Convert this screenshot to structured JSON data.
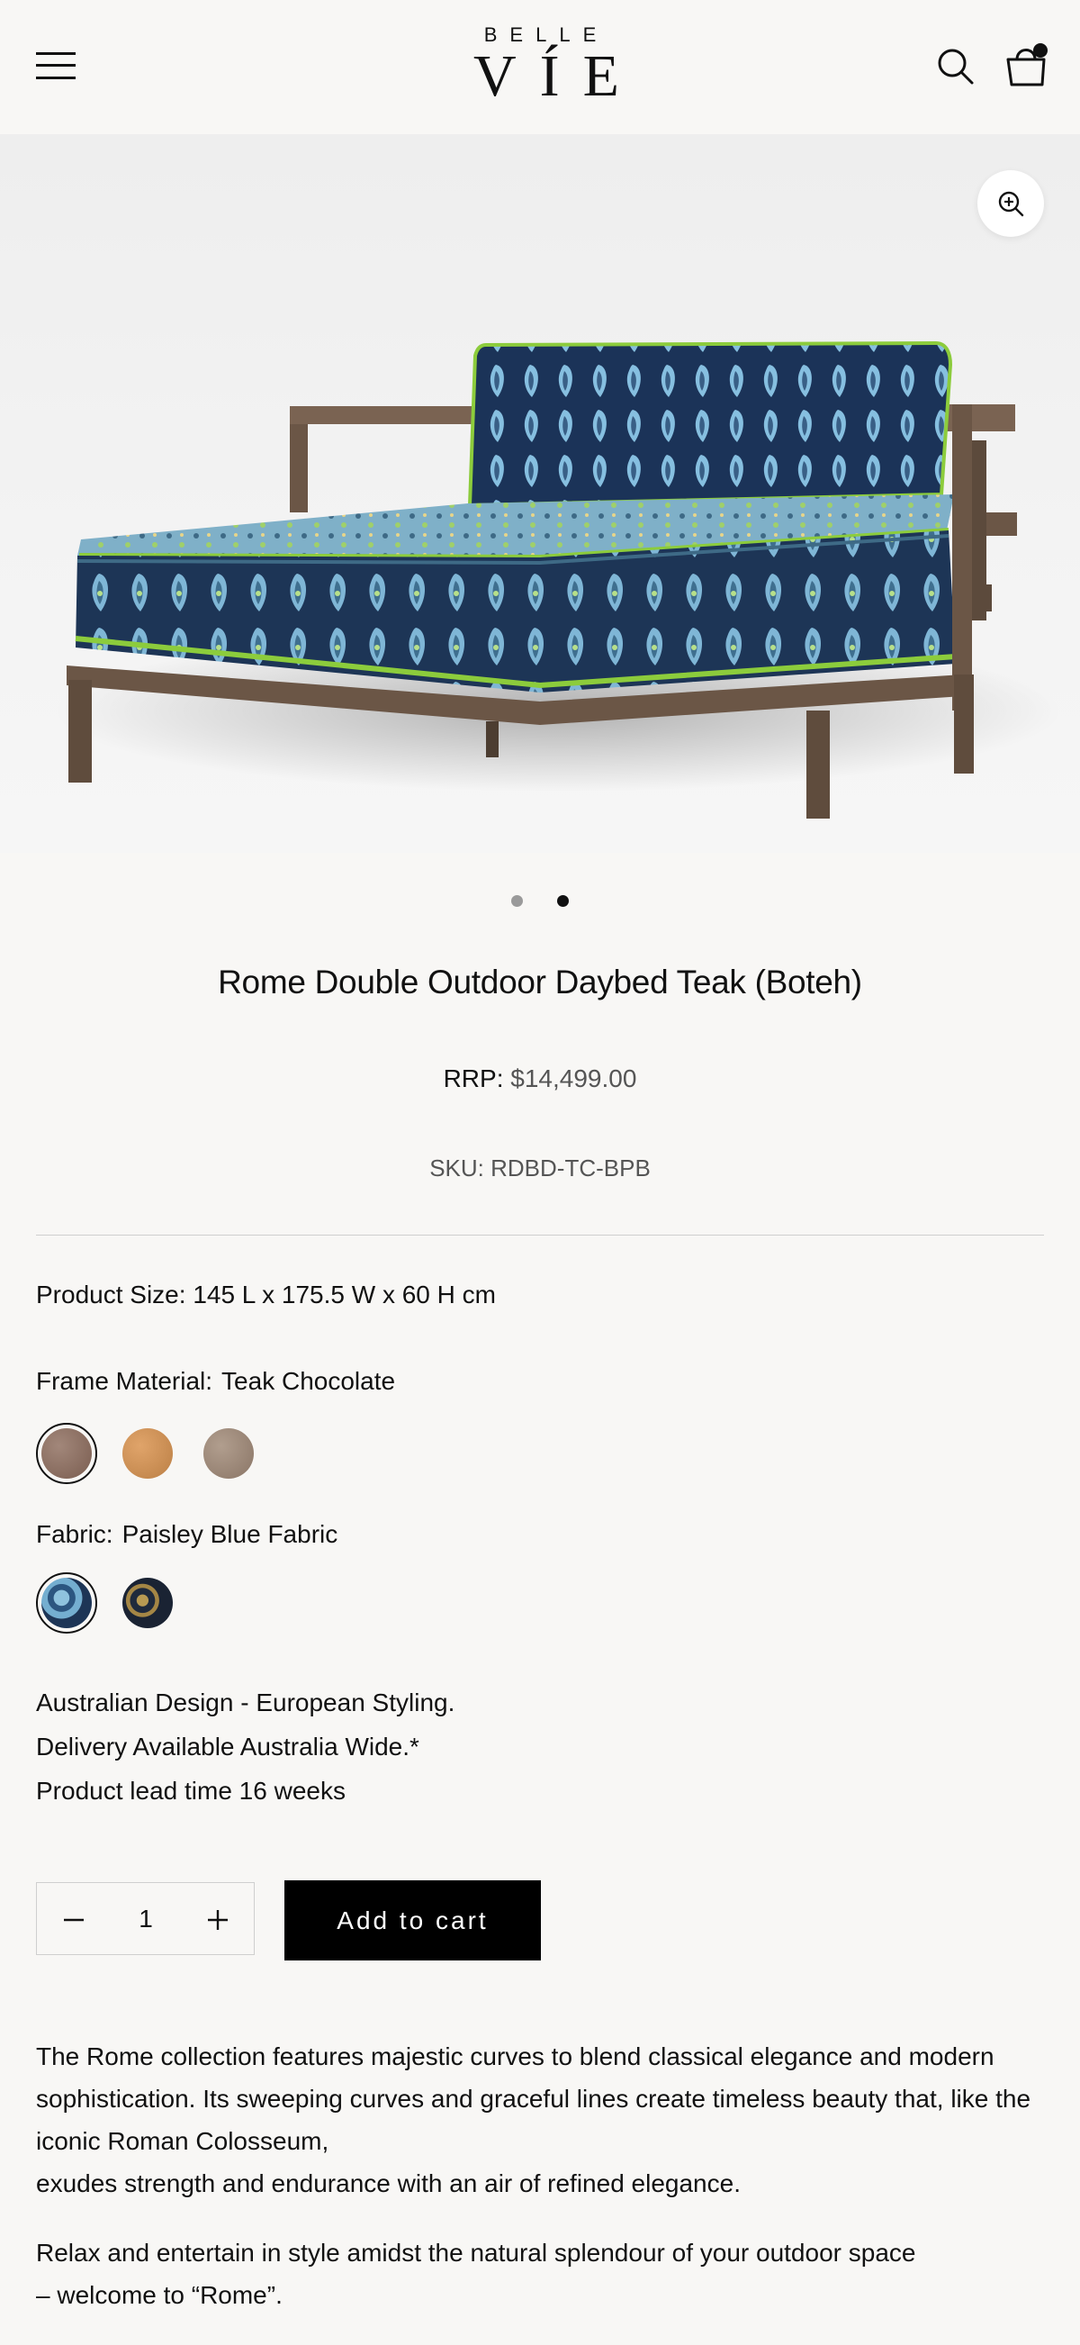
{
  "header": {
    "logo_top": "BELLE",
    "logo_main": "VÍE",
    "menu_icon": "hamburger-menu-icon",
    "search_icon": "search-icon",
    "cart_icon": "shopping-bag-icon"
  },
  "gallery": {
    "zoom_icon": "zoom-in-icon",
    "slide_count": 2,
    "active_slide": 2
  },
  "product": {
    "title": "Rome Double Outdoor Daybed Teak (Boteh)",
    "rrp_label": "RRP:",
    "price": "$14,499.00",
    "sku": "SKU: RDBD-TC-BPB",
    "size_label": "Product Size:",
    "size_value": "145 L x 175.5 W x 60 H cm",
    "frame_label": "Frame Material:",
    "frame_value": "Teak Chocolate",
    "frame_swatches": [
      {
        "name": "Teak Chocolate",
        "color": "#8a6d5f",
        "selected": true
      },
      {
        "name": "Teak Natural",
        "color": "#c98c4e",
        "selected": false
      },
      {
        "name": "Teak Grey",
        "color": "#9c8878",
        "selected": false
      }
    ],
    "fabric_label": "Fabric:",
    "fabric_value": "Paisley Blue Fabric",
    "fabric_swatches": [
      {
        "name": "Paisley Blue Fabric",
        "color": "#3f6f8f",
        "selected": true
      },
      {
        "name": "Paisley Navy Gold Fabric",
        "color": "#1f2a3c",
        "selected": false
      }
    ],
    "features": [
      "Australian Design - European Styling.",
      "Delivery Available Australia Wide.*",
      "Product lead time 16 weeks"
    ]
  },
  "cart": {
    "quantity": "1",
    "minus_icon": "minus-icon",
    "plus_icon": "plus-icon",
    "add_label": "Add to cart"
  },
  "description": {
    "paragraph1_lines": [
      "The Rome collection features majestic curves to blend classical elegance and modern",
      "sophistication. Its sweeping curves and graceful lines create timeless beauty that, like the",
      "iconic Roman Colosseum,",
      "exudes strength and endurance with an air of refined elegance."
    ],
    "paragraph2_lines": [
      "Relax and entertain in style amidst the natural splendour of your outdoor space",
      "– welcome to “Rome”."
    ]
  },
  "colors": {
    "background": "#f8f7f5",
    "button": "#000000",
    "teak": "#6b5646",
    "fabric_navy": "#1d3556",
    "fabric_light": "#7fb6d6",
    "piping_green": "#8ccc3c"
  }
}
